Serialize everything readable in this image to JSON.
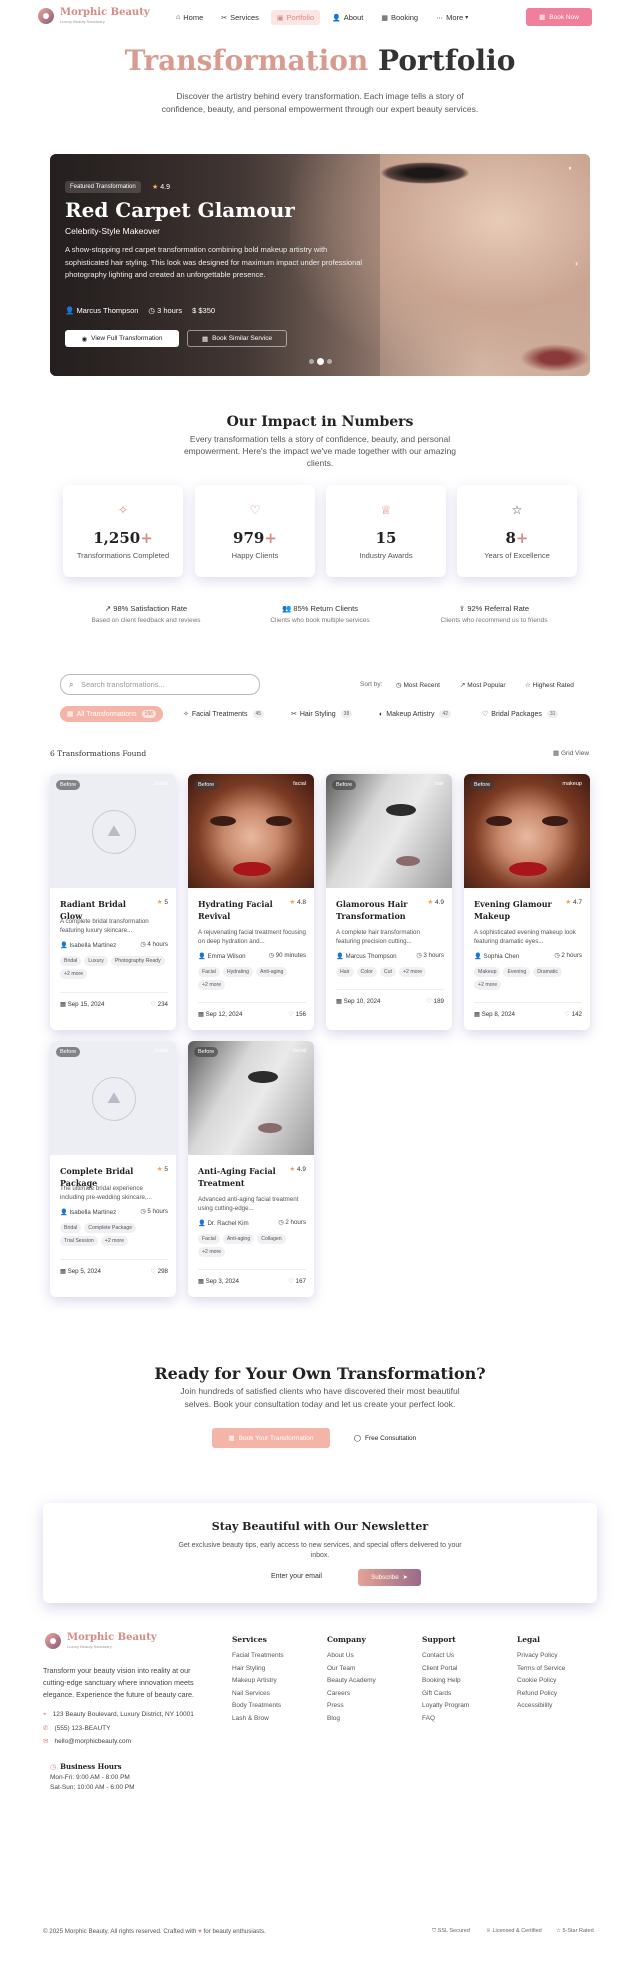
{
  "brand": {
    "name": "Morphic Beauty",
    "tagline": "Luxury Beauty Sanctuary"
  },
  "nav": {
    "items": [
      {
        "icon": "⌂",
        "label": "Home"
      },
      {
        "icon": "✂",
        "label": "Services"
      },
      {
        "icon": "▣",
        "label": "Portfolio"
      },
      {
        "icon": "👤",
        "label": "About"
      },
      {
        "icon": "▦",
        "label": "Booking"
      },
      {
        "icon": "⋯",
        "label": "More"
      }
    ],
    "book_label": "Book Now"
  },
  "hero": {
    "title_accent": "Transformation",
    "title_rest": "Portfolio",
    "subtitle": "Discover the artistry behind every transformation. Each image tells a story of confidence, beauty, and personal empowerment through our expert beauty services."
  },
  "featured": {
    "badge": "Featured Transformation",
    "rating": "4.9",
    "title": "Red Carpet Glamour",
    "subtitle": "Celebrity-Style Makeover",
    "description": "A show-stopping red carpet transformation combining bold makeup artistry with sophisticated hair styling. This look was designed for maximum impact under professional photography lighting and created an unforgettable presence.",
    "artist": "Marcus Thompson",
    "duration": "3 hours",
    "price": "$350",
    "view_label": "View Full Transformation",
    "book_label": "Book Similar Service"
  },
  "impact": {
    "title": "Our Impact in Numbers",
    "subtitle": "Every transformation tells a story of confidence, beauty, and personal empowerment. Here's the impact we've made together with our amazing clients.",
    "stats": [
      {
        "num": "1,250",
        "plus": "+",
        "label": "Transformations Completed",
        "icon": "✧"
      },
      {
        "num": "979",
        "plus": "+",
        "label": "Happy Clients",
        "icon": "♡"
      },
      {
        "num": "15",
        "plus": "",
        "label": "Industry Awards",
        "icon": "♕"
      },
      {
        "num": "8",
        "plus": "+",
        "label": "Years of Excellence",
        "icon": "☆"
      }
    ],
    "rates": [
      {
        "title": "98% Satisfaction Rate",
        "sub": "Based on client feedback and reviews",
        "icon": "↗"
      },
      {
        "title": "85% Return Clients",
        "sub": "Clients who book multiple services",
        "icon": "👥"
      },
      {
        "title": "92% Referral Rate",
        "sub": "Clients who recommend us to friends",
        "icon": "⇪"
      }
    ]
  },
  "filters": {
    "search_placeholder": "Search transformations...",
    "sort_label": "Sort by:",
    "sort_options": [
      "Most Recent",
      "Most Popular",
      "Highest Rated"
    ],
    "chips": [
      {
        "label": "All Transformations",
        "count": "156"
      },
      {
        "label": "Facial Treatments",
        "count": "45"
      },
      {
        "label": "Hair Styling",
        "count": "38"
      },
      {
        "label": "Makeup Artistry",
        "count": "42"
      },
      {
        "label": "Bridal Packages",
        "count": "31"
      }
    ],
    "found": "6 Transformations Found",
    "view": "Grid View"
  },
  "cards": [
    {
      "badge": "Before",
      "cat": "bridal",
      "title": "Radiant Bridal Glow",
      "rating": "5",
      "desc": "A complete bridal transformation featuring luxury skincare...",
      "artist": "Isabella Martinez",
      "duration": "4 hours",
      "tags": [
        "Bridal",
        "Luxury",
        "Photography Ready",
        "+2 more"
      ],
      "date": "Sep 15, 2024",
      "likes": "234"
    },
    {
      "badge": "Before",
      "cat": "facial",
      "title": "Hydrating Facial Revival",
      "rating": "4.8",
      "desc": "A rejuvenating facial treatment focusing on deep hydration and...",
      "artist": "Emma Wilson",
      "duration": "90 minutes",
      "tags": [
        "Facial",
        "Hydrating",
        "Anti-aging",
        "+2 more"
      ],
      "date": "Sep 12, 2024",
      "likes": "156"
    },
    {
      "badge": "Before",
      "cat": "hair",
      "title": "Glamorous Hair Transformation",
      "rating": "4.9",
      "desc": "A complete hair transformation featuring precision cutting...",
      "artist": "Marcus Thompson",
      "duration": "3 hours",
      "tags": [
        "Hair",
        "Color",
        "Cut",
        "+2 more"
      ],
      "date": "Sep 10, 2024",
      "likes": "189"
    },
    {
      "badge": "Before",
      "cat": "makeup",
      "title": "Evening Glamour Makeup",
      "rating": "4.7",
      "desc": "A sophisticated evening makeup look featuring dramatic eyes...",
      "artist": "Sophia Chen",
      "duration": "2 hours",
      "tags": [
        "Makeup",
        "Evening",
        "Dramatic",
        "+2 more"
      ],
      "date": "Sep 8, 2024",
      "likes": "142"
    },
    {
      "badge": "Before",
      "cat": "bridal",
      "title": "Complete Bridal Package",
      "rating": "5",
      "desc": "The ultimate bridal experience including pre-wedding skincare,...",
      "artist": "Isabella Martinez",
      "duration": "5 hours",
      "tags": [
        "Bridal",
        "Complete Package",
        "Trial Session",
        "+2 more"
      ],
      "date": "Sep 5, 2024",
      "likes": "298"
    },
    {
      "badge": "Before",
      "cat": "facial",
      "title": "Anti-Aging Facial Treatment",
      "rating": "4.9",
      "desc": "Advanced anti-aging facial treatment using cutting-edge...",
      "artist": "Dr. Rachel Kim",
      "duration": "2 hours",
      "tags": [
        "Facial",
        "Anti-aging",
        "Collagen",
        "+2 more"
      ],
      "date": "Sep 3, 2024",
      "likes": "167"
    }
  ],
  "cta": {
    "title": "Ready for Your Own Transformation?",
    "subtitle": "Join hundreds of satisfied clients who have discovered their most beautiful selves. Book your consultation today and let us create your perfect look.",
    "book_label": "Book Your Transformation",
    "consult_label": "Free Consultation"
  },
  "newsletter": {
    "title": "Stay Beautiful with Our Newsletter",
    "subtitle": "Get exclusive beauty tips, early access to new services, and special offers delivered to your inbox.",
    "placeholder": "Enter your email",
    "button": "Subscribe"
  },
  "footer": {
    "description": "Transform your beauty vision into reality at our cutting-edge sanctuary where innovation meets elegance. Experience the future of beauty care.",
    "address": "123 Beauty Boulevard, Luxury District, NY 10001",
    "phone": "(555) 123-BEAUTY",
    "email": "hello@morphicbeauty.com",
    "hours_title": "Business Hours",
    "hours": [
      "Mon-Fri: 9:00 AM - 8:00 PM",
      "Sat-Sun: 10:00 AM - 6:00 PM"
    ],
    "columns": [
      {
        "title": "Services",
        "items": [
          "Facial Treatments",
          "Hair Styling",
          "Makeup Artistry",
          "Nail Services",
          "Body Treatments",
          "Lash & Brow"
        ]
      },
      {
        "title": "Company",
        "items": [
          "About Us",
          "Our Team",
          "Beauty Academy",
          "Careers",
          "Press",
          "Blog"
        ]
      },
      {
        "title": "Support",
        "items": [
          "Contact Us",
          "Client Portal",
          "Booking Help",
          "Gift Cards",
          "Loyalty Program",
          "FAQ"
        ]
      },
      {
        "title": "Legal",
        "items": [
          "Privacy Policy",
          "Terms of Service",
          "Cookie Policy",
          "Refund Policy",
          "Accessibility"
        ]
      }
    ],
    "copyright_a": "© 2025 Morphic Beauty. All rights reserved. Crafted with",
    "copyright_b": "for beauty enthusiasts.",
    "badges": [
      "SSL Secured",
      "Licensed & Certified",
      "5-Star Rated"
    ]
  }
}
